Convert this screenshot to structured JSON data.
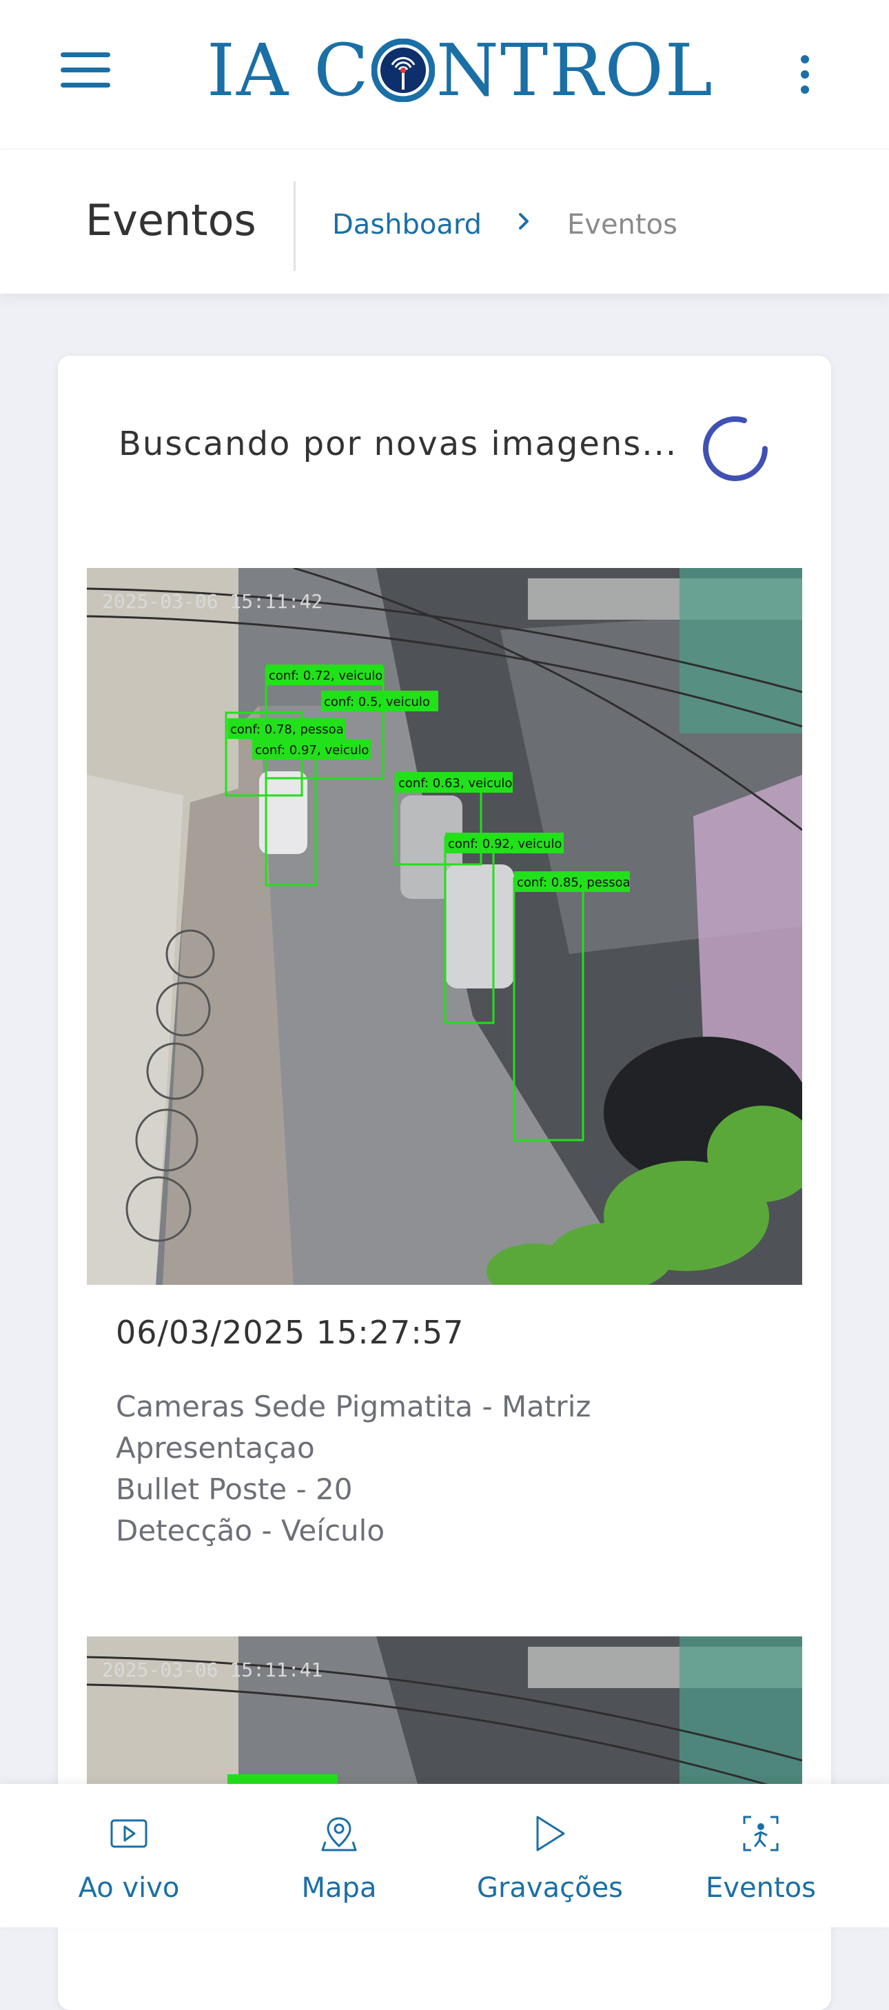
{
  "header": {
    "logo_left": "IA C",
    "logo_right": "NTROL"
  },
  "breadcrumb": {
    "title": "Eventos",
    "link": "Dashboard",
    "current": "Eventos"
  },
  "status": {
    "searching_text": "Buscando por novas imagens..."
  },
  "events": [
    {
      "timestamp_overlay": "2025-03-06 15:11:42",
      "date": "06/03/2025 15:27:57",
      "lines": [
        "Cameras Sede Pigmatita - Matriz",
        "Apresentaçao",
        "Bullet Poste - 20",
        "Detecção - Veículo"
      ],
      "detections": [
        "conf: 0.72, veiculo",
        "conf: 0.5, veiculo",
        "conf: 0.78, pessoa",
        "conf: 0.97, veiculo",
        "conf: 0.63, veiculo",
        "conf: 0.92, veiculo",
        "conf: 0.85, pessoa"
      ]
    },
    {
      "timestamp_overlay": "2025-03-06 15:11:41"
    }
  ],
  "bottom_nav": [
    {
      "label": "Ao vivo",
      "icon": "play-box-icon"
    },
    {
      "label": "Mapa",
      "icon": "map-pin-icon"
    },
    {
      "label": "Gravações",
      "icon": "play-triangle-icon"
    },
    {
      "label": "Eventos",
      "icon": "person-scan-icon"
    }
  ],
  "colors": {
    "brand": "#1a6fa6",
    "spinner": "#3f51b5",
    "detection_box": "#22e01a",
    "page_bg": "#eef0f6"
  }
}
